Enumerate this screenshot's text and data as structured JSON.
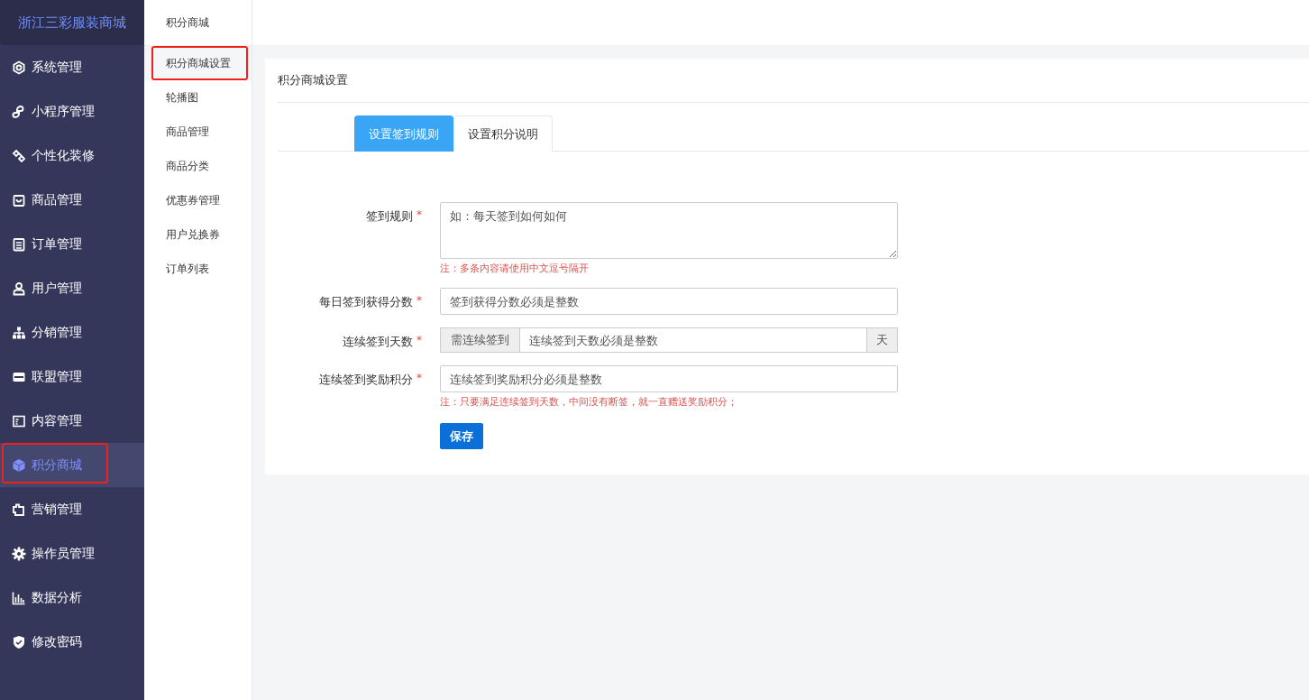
{
  "sidebar": {
    "logo": "浙江三彩服装商城",
    "items": [
      {
        "label": "系统管理",
        "selected": false
      },
      {
        "label": "小程序管理",
        "selected": false
      },
      {
        "label": "个性化装修",
        "selected": false
      },
      {
        "label": "商品管理",
        "selected": false
      },
      {
        "label": "订单管理",
        "selected": false
      },
      {
        "label": "用户管理",
        "selected": false
      },
      {
        "label": "分销管理",
        "selected": false
      },
      {
        "label": "联盟管理",
        "selected": false
      },
      {
        "label": "内容管理",
        "selected": false
      },
      {
        "label": "积分商城",
        "selected": true
      },
      {
        "label": "营销管理",
        "selected": false
      },
      {
        "label": "操作员管理",
        "selected": false
      },
      {
        "label": "数据分析",
        "selected": false
      },
      {
        "label": "修改密码",
        "selected": false
      }
    ]
  },
  "subnav": {
    "title": "积分商城",
    "items": [
      {
        "label": "积分商城设置",
        "selected": true
      },
      {
        "label": "轮播图",
        "selected": false
      },
      {
        "label": "商品管理",
        "selected": false
      },
      {
        "label": "商品分类",
        "selected": false
      },
      {
        "label": "优惠券管理",
        "selected": false
      },
      {
        "label": "用户兑换券",
        "selected": false
      },
      {
        "label": "订单列表",
        "selected": false
      }
    ]
  },
  "panel": {
    "title": "积分商城设置",
    "tabs": [
      {
        "label": "设置签到规则",
        "selected": true
      },
      {
        "label": "设置积分说明",
        "selected": false
      }
    ],
    "fields": [
      {
        "kind": "textarea",
        "label": "签到规则",
        "mark": "*",
        "placeholder": "如：每天签到如何如何",
        "hint": "注：多条内容请使用中文逗号隔开"
      },
      {
        "kind": "input",
        "label": "每日签到获得分数",
        "mark": "*",
        "placeholder": "签到获得分数必须是整数"
      },
      {
        "kind": "group",
        "label": "连续签到天数",
        "mark": "*",
        "prefix": "需连续签到",
        "placeholder": "连续签到天数必须是整数",
        "suffix": "天"
      },
      {
        "kind": "input",
        "label": "连续签到奖励积分",
        "mark": "*",
        "placeholder": "连续签到奖励积分必须是整数",
        "hint": "注：只要满足连续签到天数，中间没有断签，就一直赠送奖励积分；"
      }
    ],
    "save_button": "保存"
  }
}
